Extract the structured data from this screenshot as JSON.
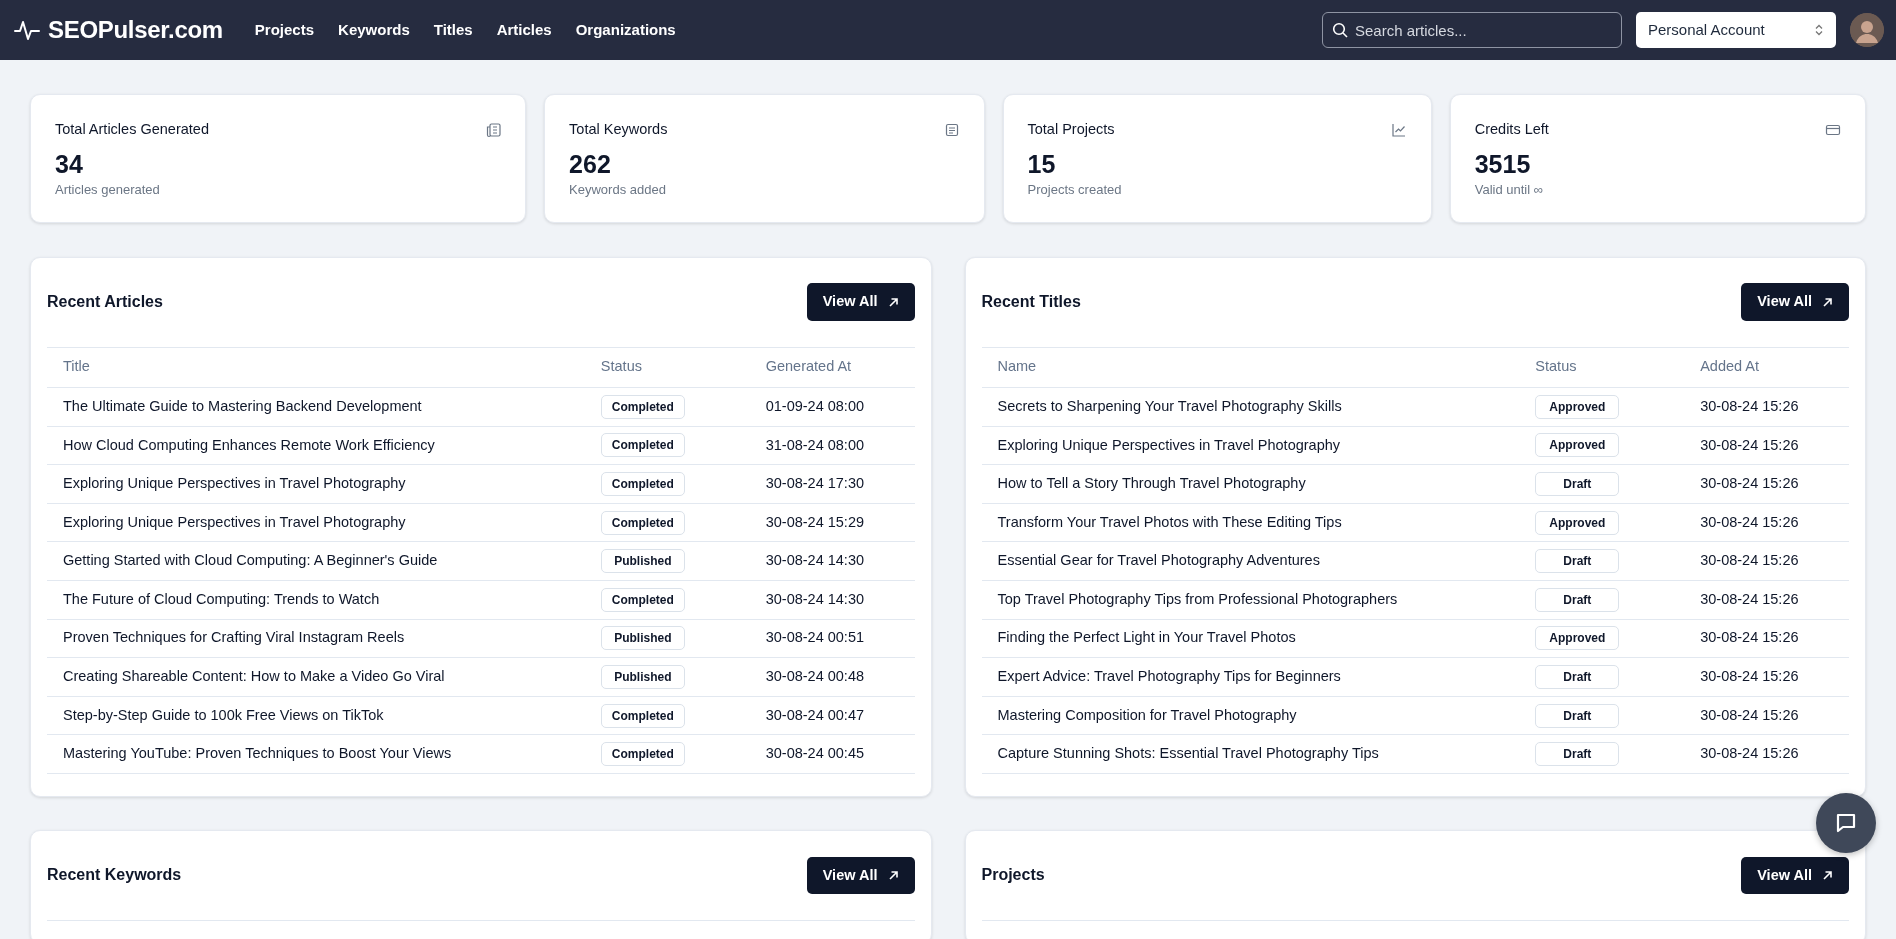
{
  "navbar": {
    "brand": "SEOPulser.com",
    "links": [
      "Projects",
      "Keywords",
      "Titles",
      "Articles",
      "Organizations"
    ],
    "search": {
      "placeholder": "Search articles..."
    },
    "account": "Personal Account"
  },
  "stats": [
    {
      "label": "Total Articles Generated",
      "value": "34",
      "caption": "Articles generated"
    },
    {
      "label": "Total Keywords",
      "value": "262",
      "caption": "Keywords added"
    },
    {
      "label": "Total Projects",
      "value": "15",
      "caption": "Projects created"
    },
    {
      "label": "Credits Left",
      "value": "3515",
      "caption": "Valid until ∞"
    }
  ],
  "panels": [
    {
      "title": "Recent Articles",
      "button": "View All",
      "columns": [
        "Title",
        "Status",
        "Generated At"
      ],
      "rows": [
        [
          "The Ultimate Guide to Mastering Backend Development",
          "Completed",
          "01-09-24 08:00"
        ],
        [
          "How Cloud Computing Enhances Remote Work Efficiency",
          "Completed",
          "31-08-24 08:00"
        ],
        [
          "Exploring Unique Perspectives in Travel Photography",
          "Completed",
          "30-08-24 17:30"
        ],
        [
          "Exploring Unique Perspectives in Travel Photography",
          "Completed",
          "30-08-24 15:29"
        ],
        [
          "Getting Started with Cloud Computing: A Beginner's Guide",
          "Published",
          "30-08-24 14:30"
        ],
        [
          "The Future of Cloud Computing: Trends to Watch",
          "Completed",
          "30-08-24 14:30"
        ],
        [
          "Proven Techniques for Crafting Viral Instagram Reels",
          "Published",
          "30-08-24 00:51"
        ],
        [
          "Creating Shareable Content: How to Make a Video Go Viral",
          "Published",
          "30-08-24 00:48"
        ],
        [
          "Step-by-Step Guide to 100k Free Views on TikTok",
          "Completed",
          "30-08-24 00:47"
        ],
        [
          "Mastering YouTube: Proven Techniques to Boost Your Views",
          "Completed",
          "30-08-24 00:45"
        ]
      ]
    },
    {
      "title": "Recent Titles",
      "button": "View All",
      "columns": [
        "Name",
        "Status",
        "Added At"
      ],
      "rows": [
        [
          "Secrets to Sharpening Your Travel Photography Skills",
          "Approved",
          "30-08-24 15:26"
        ],
        [
          "Exploring Unique Perspectives in Travel Photography",
          "Approved",
          "30-08-24 15:26"
        ],
        [
          "How to Tell a Story Through Travel Photography",
          "Draft",
          "30-08-24 15:26"
        ],
        [
          "Transform Your Travel Photos with These Editing Tips",
          "Approved",
          "30-08-24 15:26"
        ],
        [
          "Essential Gear for Travel Photography Adventures",
          "Draft",
          "30-08-24 15:26"
        ],
        [
          "Top Travel Photography Tips from Professional Photographers",
          "Draft",
          "30-08-24 15:26"
        ],
        [
          "Finding the Perfect Light in Your Travel Photos",
          "Approved",
          "30-08-24 15:26"
        ],
        [
          "Expert Advice: Travel Photography Tips for Beginners",
          "Draft",
          "30-08-24 15:26"
        ],
        [
          "Mastering Composition for Travel Photography",
          "Draft",
          "30-08-24 15:26"
        ],
        [
          "Capture Stunning Shots: Essential Travel Photography Tips",
          "Draft",
          "30-08-24 15:26"
        ]
      ]
    },
    {
      "title": "Recent Keywords",
      "button": "View All"
    },
    {
      "title": "Projects",
      "button": "View All"
    }
  ]
}
